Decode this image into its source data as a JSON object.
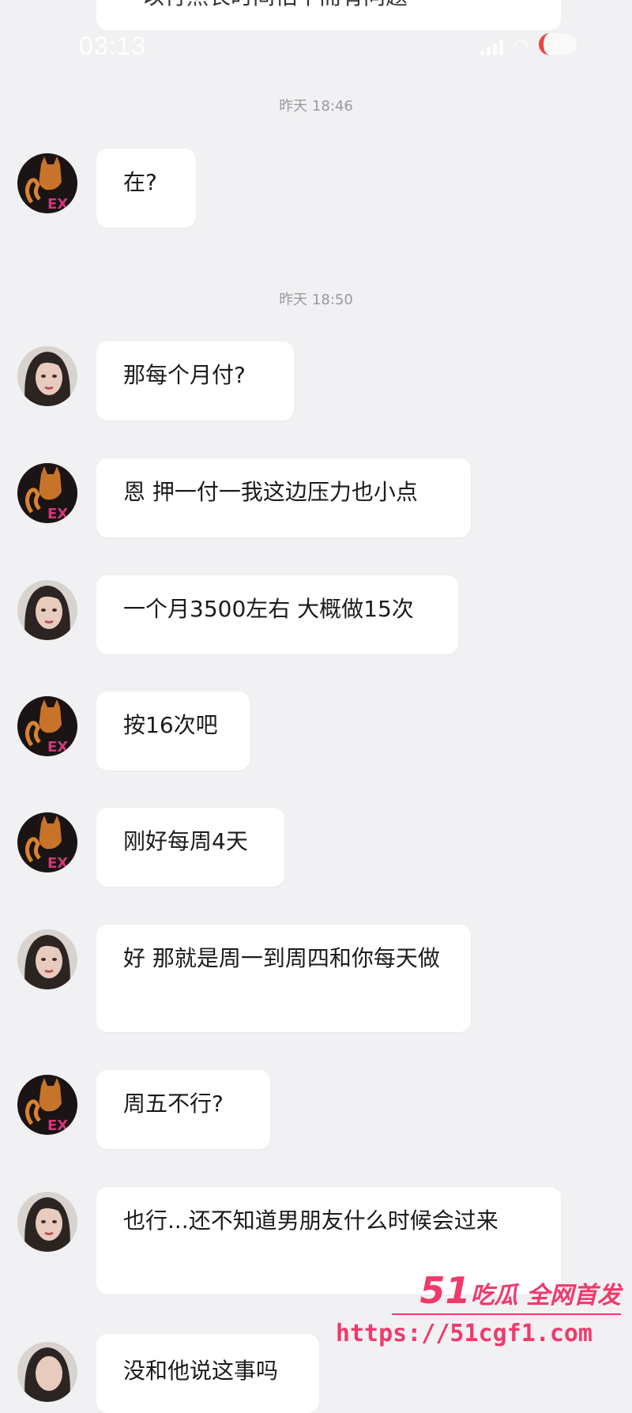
{
  "status_bar": {
    "time": "03:13",
    "battery": "16"
  },
  "top_partial_message": "以行然长时间怕不而有问题",
  "timestamps": [
    "昨天 18:46",
    "昨天 18:50"
  ],
  "messages": [
    {
      "sender": "cat",
      "text": "在?"
    },
    {
      "sender": "woman",
      "text": "那每个月付?"
    },
    {
      "sender": "cat",
      "text": "恩 押一付一我这边压力也小点"
    },
    {
      "sender": "woman",
      "text": "一个月3500左右 大概做15次"
    },
    {
      "sender": "cat",
      "text": "按16次吧"
    },
    {
      "sender": "cat",
      "text": "刚好每周4天"
    },
    {
      "sender": "woman",
      "text": "好 那就是周一到周四和你每天做"
    },
    {
      "sender": "cat",
      "text": "周五不行?"
    },
    {
      "sender": "woman",
      "text": "也行...还不知道男朋友什么时候会过来"
    },
    {
      "sender": "woman",
      "text": "没和他说这事吗"
    }
  ],
  "avatar_labels": {
    "cat": "EX"
  },
  "watermark": {
    "brand_number": "51",
    "brand_text": "吃瓜 全网首发",
    "url": "https://51cgf1.com"
  },
  "colors": {
    "background": "#f1f1f3",
    "bubble": "#ffffff",
    "watermark": "#ef3a6c"
  }
}
